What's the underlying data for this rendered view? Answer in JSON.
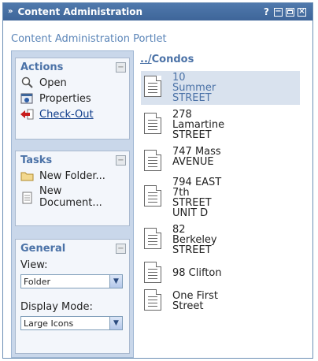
{
  "window": {
    "title": "Content Administration",
    "collapse_glyph": "»",
    "help_glyph": "?",
    "minimize_glyph": "−",
    "maximize_glyph": "",
    "close_glyph": "×"
  },
  "portlet_title": "Content Administration Portlet",
  "actions": {
    "title": "Actions",
    "items": [
      {
        "label": "Open",
        "icon": "magnifier-icon"
      },
      {
        "label": "Properties",
        "icon": "properties-icon"
      },
      {
        "label": "Check-Out",
        "icon": "checkout-arrow-icon"
      }
    ]
  },
  "tasks": {
    "title": "Tasks",
    "items": [
      {
        "label": "New Folder...",
        "icon": "folder-icon"
      },
      {
        "label": "New Document...",
        "icon": "document-icon"
      }
    ]
  },
  "general": {
    "title": "General",
    "view_label": "View:",
    "view_value": "Folder",
    "display_label": "Display Mode:",
    "display_value": "Large Icons"
  },
  "breadcrumb": {
    "up": "../",
    "folder": "Condos"
  },
  "documents": [
    {
      "line1": "10",
      "line2": "Summer",
      "line3": "STREET",
      "line4": ""
    },
    {
      "line1": "278",
      "line2": "Lamartine",
      "line3": "STREET",
      "line4": ""
    },
    {
      "line1": "747 Mass",
      "line2": "AVENUE",
      "line3": "",
      "line4": ""
    },
    {
      "line1": "794 EAST",
      "line2": "7th",
      "line3": "STREET",
      "line4": "UNIT D"
    },
    {
      "line1": "82",
      "line2": "Berkeley",
      "line3": "STREET",
      "line4": ""
    },
    {
      "line1": "98 Clifton",
      "line2": "",
      "line3": "",
      "line4": ""
    },
    {
      "line1": "One First",
      "line2": "Street",
      "line3": "",
      "line4": ""
    }
  ],
  "colors": {
    "titlebar": "#4f79ac",
    "accent": "#4b72a7",
    "panel_bg": "#c9d7ea",
    "selected_bg": "#d9e2ee"
  }
}
